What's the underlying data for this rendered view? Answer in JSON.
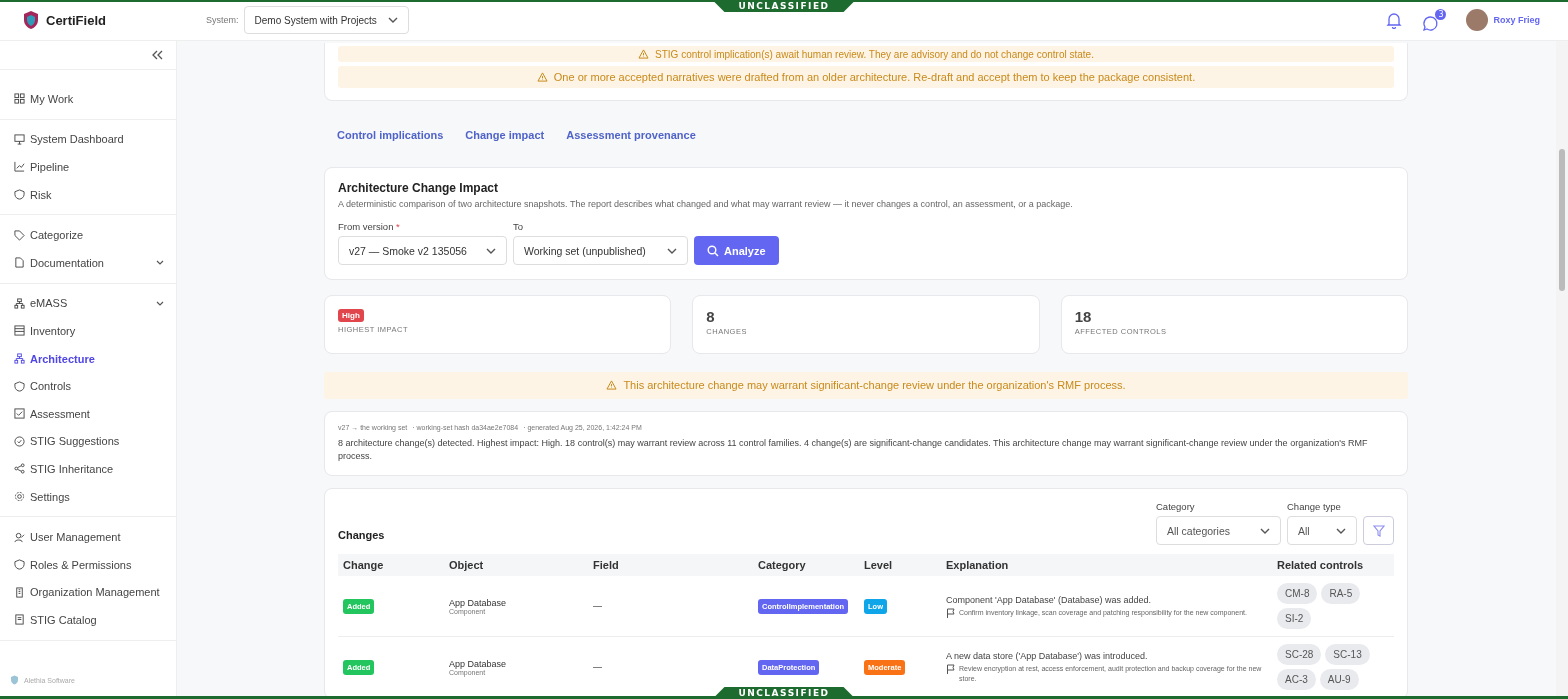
{
  "classification_banner": {
    "top": "UNCLASSIFIED",
    "bottom": "UNCLASSIFIED"
  },
  "header": {
    "app_name": "CertiField",
    "system_label": "System:",
    "system_value": "Demo System with Projects",
    "messages_badge": "3",
    "user_name": "Roxy Frieg"
  },
  "sidebar": {
    "groups": [
      {
        "items": [
          {
            "label": "My Work",
            "selected": false,
            "expandable": false
          }
        ]
      },
      {
        "items": [
          {
            "label": "System Dashboard",
            "selected": false,
            "expandable": false
          },
          {
            "label": "Pipeline",
            "selected": false,
            "expandable": false
          },
          {
            "label": "Risk",
            "selected": false,
            "expandable": false
          }
        ]
      },
      {
        "items": [
          {
            "label": "Categorize",
            "selected": false,
            "expandable": false
          },
          {
            "label": "Documentation",
            "selected": false,
            "expandable": true
          }
        ]
      },
      {
        "items": [
          {
            "label": "eMASS",
            "selected": false,
            "expandable": true
          },
          {
            "label": "Inventory",
            "selected": false,
            "expandable": false
          },
          {
            "label": "Architecture",
            "selected": true,
            "expandable": false
          },
          {
            "label": "Controls",
            "selected": false,
            "expandable": false
          },
          {
            "label": "Assessment",
            "selected": false,
            "expandable": false
          },
          {
            "label": "STIG Suggestions",
            "selected": false,
            "expandable": false
          },
          {
            "label": "STIG Inheritance",
            "selected": false,
            "expandable": false
          },
          {
            "label": "Settings",
            "selected": false,
            "expandable": false
          }
        ]
      },
      {
        "items": [
          {
            "label": "User Management",
            "selected": false,
            "expandable": false
          },
          {
            "label": "Roles & Permissions",
            "selected": false,
            "expandable": false
          },
          {
            "label": "Organization Management",
            "selected": false,
            "expandable": false
          },
          {
            "label": "STIG Catalog",
            "selected": false,
            "expandable": false
          }
        ]
      }
    ],
    "footer": "Alethia Software"
  },
  "alerts": [
    "STIG control implication(s) await human review. They are advisory and do not change control state.",
    "One or more accepted narratives were drafted from an older architecture. Re-draft and accept them to keep the package consistent."
  ],
  "tabs": [
    {
      "label": "Control implications"
    },
    {
      "label": "Change impact"
    },
    {
      "label": "Assessment provenance"
    }
  ],
  "impact_panel": {
    "title": "Architecture Change Impact",
    "description": "A deterministic comparison of two architecture snapshots. The report describes what changed and what may warrant review — it never changes a control, an assessment, or a package.",
    "from_label": "From version",
    "from_required": "*",
    "from_value": "v27 — Smoke v2 135056",
    "to_label": "To",
    "to_value": "Working set (unpublished)",
    "analyze_button": "Analyze"
  },
  "stats": [
    {
      "kind": "badge",
      "value": "High",
      "color": "#e0464b",
      "label": "HIGHEST IMPACT"
    },
    {
      "kind": "number",
      "value": "8",
      "label": "CHANGES"
    },
    {
      "kind": "number",
      "value": "18",
      "label": "AFFECTED CONTROLS"
    }
  ],
  "significance_warning": "This architecture change may warrant significant-change review under the organization's RMF process.",
  "summary": {
    "meta": [
      "v27 → the working set",
      "· working-set hash da34ae2e7084",
      "· generated Aug 25, 2026, 1:42:24 PM"
    ],
    "text": "8 architecture change(s) detected. Highest impact: High. 18 control(s) may warrant review across 11 control families. 4 change(s) are significant-change candidates. This architecture change may warrant significant-change review under the organization's RMF process."
  },
  "changes": {
    "title": "Changes",
    "category_filter": {
      "label": "Category",
      "value": "All categories"
    },
    "change_type_filter": {
      "label": "Change type",
      "value": "All"
    },
    "columns": [
      "Change",
      "Object",
      "Field",
      "Category",
      "Level",
      "Explanation",
      "Related controls"
    ],
    "rows": [
      {
        "change": {
          "text": "Added",
          "color": "#22c55e"
        },
        "object": "App Database",
        "object_type": "Component",
        "field": "—",
        "category": {
          "text": "ControlImplementation",
          "color": "#6366f1"
        },
        "level": {
          "text": "Low",
          "color": "#0ea5e9"
        },
        "explanation": "Component 'App Database' (Database) was added.",
        "note": "Confirm inventory linkage, scan coverage and patching responsibility for the new component.",
        "controls": [
          "CM-8",
          "RA-5",
          "SI-2"
        ]
      },
      {
        "change": {
          "text": "Added",
          "color": "#22c55e"
        },
        "object": "App Database",
        "object_type": "Component",
        "field": "—",
        "category": {
          "text": "DataProtection",
          "color": "#6366f1"
        },
        "level": {
          "text": "Moderate",
          "color": "#f97316"
        },
        "explanation": "A new data store ('App Database') was introduced.",
        "note": "Review encryption at rest, access enforcement, audit protection and backup coverage for the new store.",
        "controls": [
          "SC-28",
          "SC-13",
          "AC-3",
          "AU-9"
        ]
      }
    ]
  }
}
